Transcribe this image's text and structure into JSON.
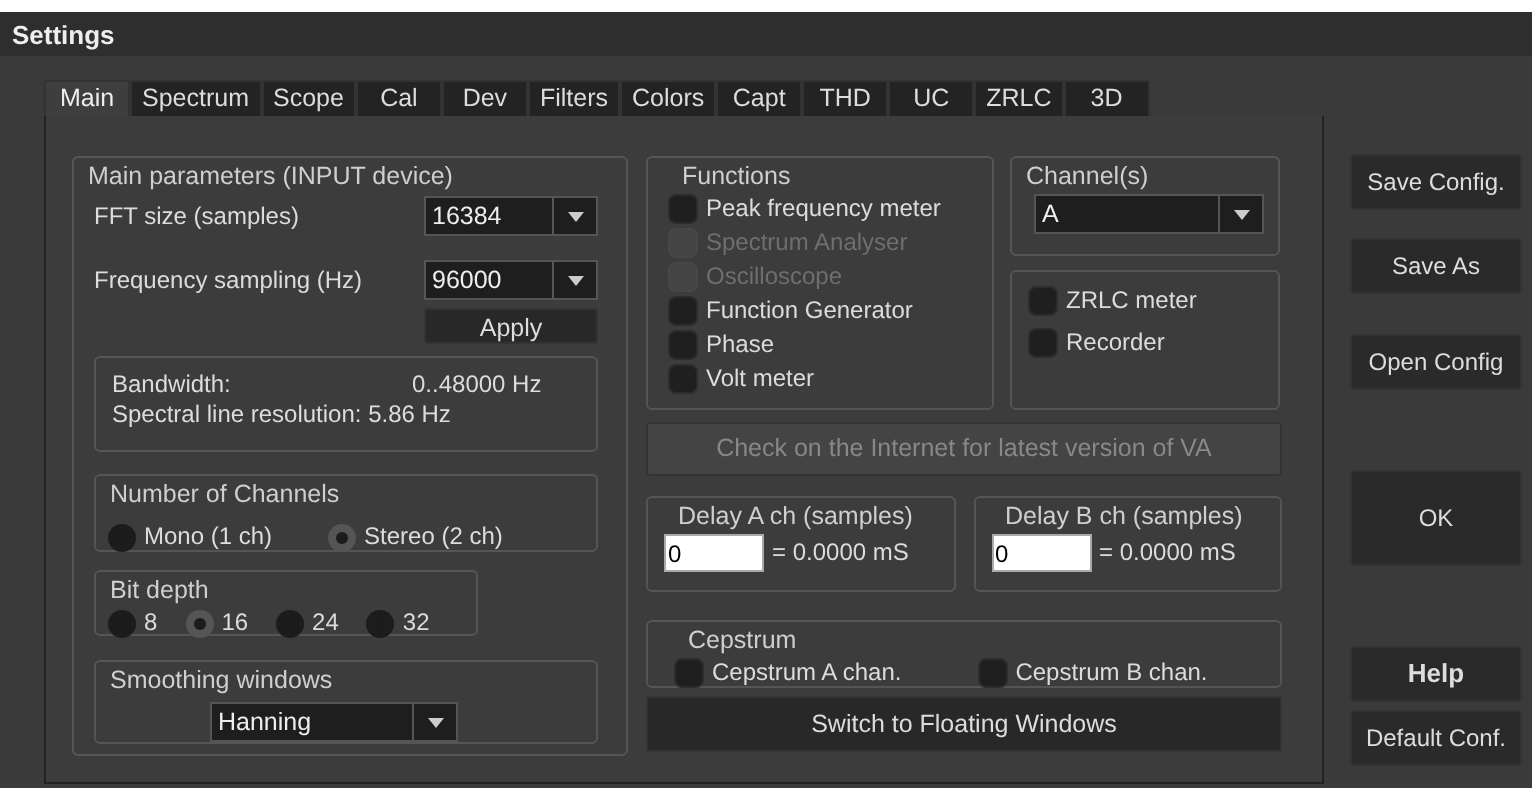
{
  "window": {
    "title": "Settings"
  },
  "tabs": [
    {
      "label": "Main",
      "selected": true
    },
    {
      "label": "Spectrum",
      "selected": false
    },
    {
      "label": "Scope",
      "selected": false
    },
    {
      "label": "Cal",
      "selected": false
    },
    {
      "label": "Dev",
      "selected": false
    },
    {
      "label": "Filters",
      "selected": false
    },
    {
      "label": "Colors",
      "selected": false
    },
    {
      "label": "Capt",
      "selected": false
    },
    {
      "label": "THD",
      "selected": false
    },
    {
      "label": "UC",
      "selected": false
    },
    {
      "label": "ZRLC",
      "selected": false
    },
    {
      "label": "3D",
      "selected": false
    }
  ],
  "main_parameters": {
    "title": "Main parameters (INPUT device)",
    "fft_size": {
      "label": "FFT size (samples)",
      "value": "16384"
    },
    "frequency_sampling": {
      "label": "Frequency sampling (Hz)",
      "value": "96000"
    },
    "apply_button": "Apply",
    "bandwidth": {
      "label": "Bandwidth:",
      "value": "0..48000 Hz"
    },
    "resolution": "Spectral line resolution: 5.86 Hz",
    "number_of_channels": {
      "title": "Number of Channels",
      "options": [
        {
          "label": "Mono (1 ch)",
          "selected": false
        },
        {
          "label": "Stereo (2 ch)",
          "selected": true
        }
      ]
    },
    "bit_depth": {
      "title": "Bit depth",
      "options": [
        {
          "label": "8",
          "selected": false
        },
        {
          "label": "16",
          "selected": true
        },
        {
          "label": "24",
          "selected": false
        },
        {
          "label": "32",
          "selected": false
        }
      ]
    },
    "smoothing_windows": {
      "title": "Smoothing windows",
      "value": "Hanning"
    }
  },
  "functions": {
    "title": "Functions",
    "items": [
      {
        "label": "Peak frequency meter",
        "checked": false,
        "disabled": false
      },
      {
        "label": "Spectrum Analyser",
        "checked": false,
        "disabled": true
      },
      {
        "label": "Oscilloscope",
        "checked": false,
        "disabled": true
      },
      {
        "label": "Function Generator",
        "checked": false,
        "disabled": false
      },
      {
        "label": "Phase",
        "checked": false,
        "disabled": false
      },
      {
        "label": "Volt meter",
        "checked": false,
        "disabled": false
      }
    ]
  },
  "channels": {
    "title": "Channel(s)",
    "value": "A"
  },
  "meters": [
    {
      "label": "ZRLC meter",
      "checked": false
    },
    {
      "label": "Recorder",
      "checked": false
    }
  ],
  "update_button": {
    "label": "Check on the Internet for latest version of VA",
    "disabled": true
  },
  "delays": [
    {
      "title": "Delay A ch (samples)",
      "value": "0",
      "result": "= 0.0000 mS"
    },
    {
      "title": "Delay B ch (samples)",
      "value": "0",
      "result": "= 0.0000 mS"
    }
  ],
  "cepstrum": {
    "title": "Cepstrum",
    "items": [
      {
        "label": "Cepstrum A chan.",
        "checked": false
      },
      {
        "label": "Cepstrum B chan.",
        "checked": false
      }
    ]
  },
  "floating_button": "Switch to Floating Windows",
  "side_buttons": [
    {
      "label": "Save Config.",
      "kind": "normal"
    },
    {
      "label": "Save As",
      "kind": "normal"
    },
    {
      "label": "Open Config",
      "kind": "normal"
    },
    {
      "label": "OK",
      "kind": "large"
    },
    {
      "label": "Help",
      "kind": "strong"
    },
    {
      "label": "Default Conf.",
      "kind": "normal"
    }
  ]
}
